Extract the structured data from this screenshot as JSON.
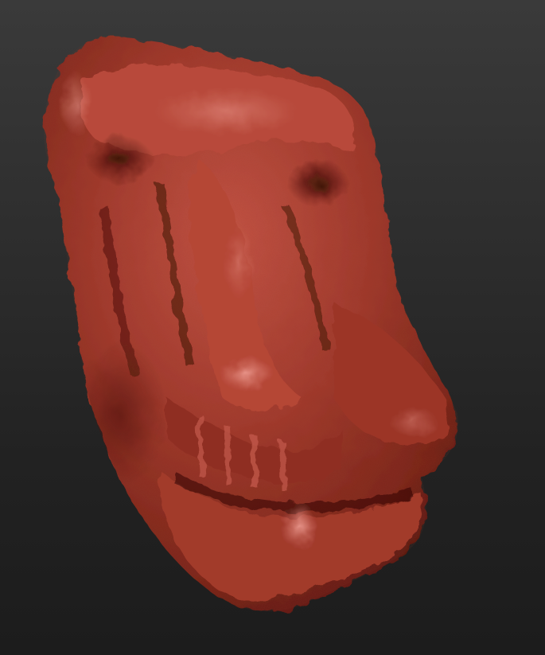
{
  "viewport": {
    "background_color": "#2b2b2b",
    "model_color": "#a0392c",
    "highlight_color": "#e0857a",
    "shadow_color": "#4a120c",
    "subject": "sculpted-creature-skull"
  }
}
